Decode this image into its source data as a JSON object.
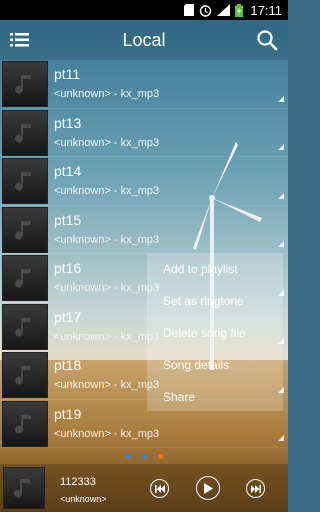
{
  "status_bar": {
    "time": "17:11",
    "icons": [
      "sd-card-icon",
      "alarm-icon",
      "signal-icon",
      "battery-charging-icon"
    ]
  },
  "header": {
    "title": "Local",
    "menu_icon": "list-menu-icon",
    "search_icon": "search-icon"
  },
  "songs": [
    {
      "title": "pt11",
      "subtitle": "<unknown> - kx_mp3"
    },
    {
      "title": "pt13",
      "subtitle": "<unknown> - kx_mp3"
    },
    {
      "title": "pt14",
      "subtitle": "<unknown> - kx_mp3"
    },
    {
      "title": "pt15",
      "subtitle": "<unknown> - kx_mp3"
    },
    {
      "title": "pt16",
      "subtitle": "<unknown> - kx_mp3"
    },
    {
      "title": "pt17",
      "subtitle": "<unknown> - kx_mp3"
    },
    {
      "title": "pt18",
      "subtitle": "<unknown> - kx_mp3"
    },
    {
      "title": "pt19",
      "subtitle": "<unknown> - kx_mp3"
    }
  ],
  "context_menu": {
    "items": [
      "Add to playlist",
      "Set as ringtone",
      "Delete song file",
      "Song details",
      "Share"
    ]
  },
  "page_dots": {
    "colors": [
      "#2b8cd8",
      "#2b8cd8",
      "#f07a1a"
    ]
  },
  "player": {
    "title": "112333",
    "subtitle": "<unknown>"
  }
}
